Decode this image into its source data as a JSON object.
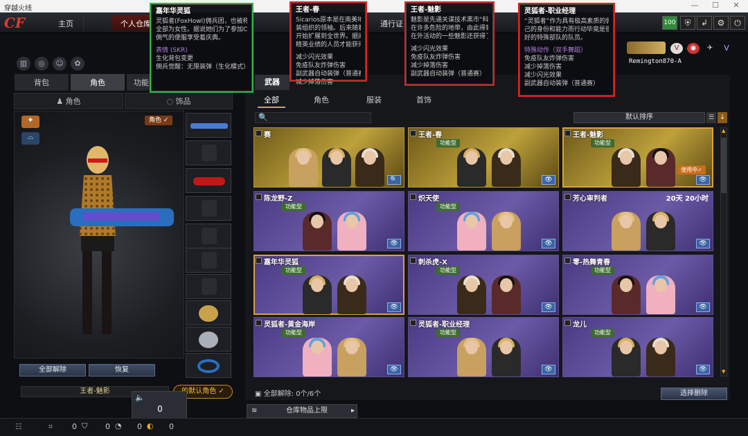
{
  "window": {
    "title": "穿越火线",
    "min": "—",
    "max": "☐",
    "close": "✕"
  },
  "topnav": {
    "logo": "CF",
    "tabs": [
      {
        "label": "主页"
      },
      {
        "label": "个人仓库"
      },
      {
        "label": "通行证"
      }
    ],
    "level_badge": "100"
  },
  "left": {
    "tabs": [
      "背包",
      "角色",
      "功能"
    ],
    "subtabs": [
      "角色",
      "饰品"
    ],
    "character_badge": "角色",
    "buttons": {
      "unequip_all": "全部解除",
      "restore": "恢复"
    },
    "selected_character": "王者-魅影",
    "default_role_btn": "的默认角色",
    "volume_value": "0"
  },
  "right": {
    "tabs": [
      "武器"
    ],
    "subtabs": [
      "全部",
      "角色",
      "服装",
      "首饰"
    ],
    "sort_label": "默认排序",
    "weapon_name": "Remington870-A",
    "footer_status": "全部解除: 0个/6个",
    "delete_btn": "选择删除",
    "storage_label": "仓库物品上限"
  },
  "cards": [
    {
      "name": "赛",
      "tag": "",
      "badge": "",
      "time": "",
      "action": "🔍"
    },
    {
      "name": "王者-春",
      "tag": "功能型",
      "badge": "",
      "time": "",
      "action": "👁"
    },
    {
      "name": "王者-魅影",
      "tag": "功能型",
      "badge": "使用中✓",
      "time": "",
      "action": "👁"
    },
    {
      "name": "陈龙野-Z",
      "tag": "功能型",
      "badge": "",
      "time": "",
      "action": "👁"
    },
    {
      "name": "炽天使",
      "tag": "功能型",
      "badge": "",
      "time": "",
      "action": "👁"
    },
    {
      "name": "芳心审判者",
      "tag": "",
      "badge": "",
      "time": "20天 20小时",
      "action": "👁"
    },
    {
      "name": "嘉年华灵狐",
      "tag": "功能型",
      "badge": "",
      "time": "",
      "action": "👁"
    },
    {
      "name": "刺杀虎-X",
      "tag": "功能型",
      "badge": "",
      "time": "",
      "action": "👁"
    },
    {
      "name": "零-热舞青春",
      "tag": "功能型",
      "badge": "",
      "time": "",
      "action": "👁"
    },
    {
      "name": "灵狐者-黄金海岸",
      "tag": "功能型",
      "badge": "",
      "time": "",
      "action": "👁"
    },
    {
      "name": "灵狐者-职业经理",
      "tag": "功能型",
      "badge": "",
      "time": "",
      "action": "👁"
    },
    {
      "name": "龙儿",
      "tag": "功能型",
      "badge": "",
      "time": "",
      "action": "👁"
    }
  ],
  "tooltips": [
    {
      "title": "嘉年华灵狐",
      "lines": [
        "灵狐者(FoxHowl)佣兵团，也被称为嘉隆商城",
        "全部为女性。据说她们为了参加CF嘉年",
        "佣气的便服享受着庆典。"
      ],
      "highlight": "表情 (SKR)",
      "extra": [
        "生化背包变更",
        "佣兵觉醒：无限装弹（生化模式）"
      ]
    },
    {
      "title": "王者-春",
      "lines": [
        "Sicarios原本是在南美地区活动的",
        "装组织的领袖。后来随着代理战争",
        "开始扩展到全世界。据闻同时间，",
        "精英业绩的人员才能获得“王者”"
      ],
      "highlight": "",
      "extra": [
        "减少闪光效果",
        "免疫队友炸弹伤害",
        "副武器自动装弹（普通赛）",
        "减少掉落伤害"
      ]
    },
    {
      "title": "王者-魅影",
      "lines": [
        "魅影是先通关谋技术黑市“科技”",
        "在许多危险的地带，由此得到她的",
        "在外活动的一些魅影还获得了“王者"
      ],
      "highlight": "",
      "extra": [
        "减少闪光效果",
        "免疫队友炸弹伤害",
        "减少掉落伤害",
        "副武器自动装弹（普通赛）"
      ]
    },
    {
      "title": "灵狐者-职业经理",
      "lines": [
        "“灵狐者”作为具有极高素质的佣兵团",
        "己的身份和能力而行动毕竟是很困难的",
        "好的特殊部队的队员。"
      ],
      "highlight": "特殊动作（双手舞蹈）",
      "extra": [
        "免疫队友炸弹伤害",
        "减少掉落伤害",
        "减少闪光效果",
        "副武器自动装弹（普通赛）"
      ]
    }
  ],
  "bottom": {
    "counts": [
      "0",
      "0",
      "0",
      "0"
    ]
  }
}
